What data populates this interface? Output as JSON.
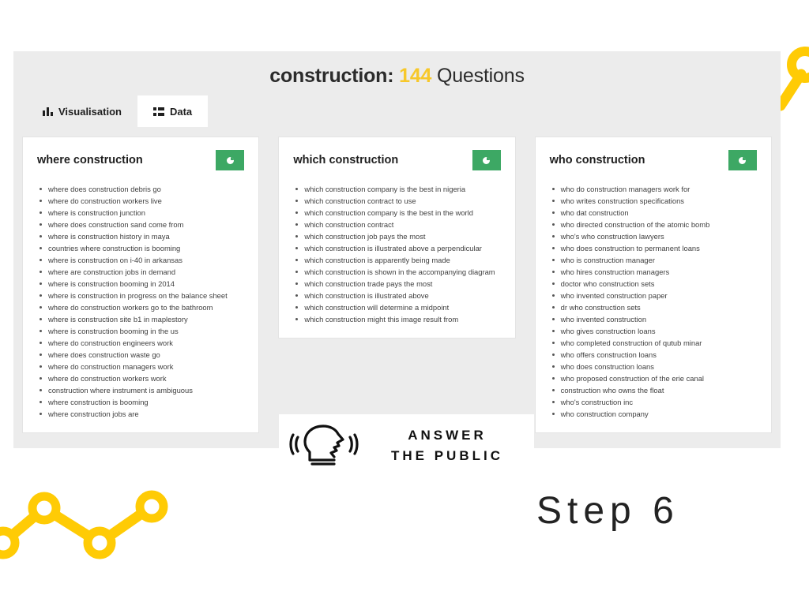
{
  "decor": {
    "accent_yellow": "#ffcb05",
    "topright_icon": "line-chart-node",
    "bottomleft_icon": "line-chart-nodes"
  },
  "panel": {
    "background": "#ececec",
    "title": {
      "keyword": "construction:",
      "count": "144",
      "suffix": "Questions"
    },
    "tabs": [
      {
        "label": "Visualisation",
        "icon": "bar-chart-icon",
        "active": false
      },
      {
        "label": "Data",
        "icon": "list-icon",
        "active": true
      }
    ],
    "cards": [
      {
        "title": "where construction",
        "button_icon": "pie-chart-icon",
        "button_color": "#3da864",
        "items": [
          "where does construction debris go",
          "where do construction workers live",
          "where is construction junction",
          "where does construction sand come from",
          "where is construction history in maya",
          "countries where construction is booming",
          "where is construction on i-40 in arkansas",
          "where are construction jobs in demand",
          "where is construction booming in 2014",
          "where is construction in progress on the balance sheet",
          "where do construction workers go to the bathroom",
          "where is construction site b1 in maplestory",
          "where is construction booming in the us",
          "where do construction engineers work",
          "where does construction waste go",
          "where do construction managers work",
          "where do construction workers work",
          "construction where instrument is ambiguous",
          "where construction is booming",
          "where construction jobs are"
        ]
      },
      {
        "title": "which construction",
        "button_icon": "pie-chart-icon",
        "button_color": "#3da864",
        "items": [
          "which construction company is the best in nigeria",
          "which construction contract to use",
          "which construction company is the best in the world",
          "which construction contract",
          "which construction job pays the most",
          "which construction is illustrated above a perpendicular",
          "which construction is apparently being made",
          "which construction is shown in the accompanying diagram",
          "which construction trade pays the most",
          "which construction is illustrated above",
          "which construction will determine a midpoint",
          "which construction might this image result from"
        ]
      },
      {
        "title": "who construction",
        "button_icon": "pie-chart-icon",
        "button_color": "#3da864",
        "items": [
          "who do construction managers work for",
          "who writes construction specifications",
          "who dat construction",
          "who directed construction of the atomic bomb",
          "who's who construction lawyers",
          "who does construction to permanent loans",
          "who is construction manager",
          "who hires construction managers",
          "doctor who construction sets",
          "who invented construction paper",
          "dr who construction sets",
          "who invented construction",
          "who gives construction loans",
          "who completed construction of qutub minar",
          "who offers construction loans",
          "who does construction loans",
          "who proposed construction of the erie canal",
          "construction who owns the float",
          "who's construction inc",
          "who construction company"
        ]
      }
    ],
    "logo": {
      "icon": "speaking-head-icon",
      "line1": "ANSWER",
      "line2": "THE PUBLIC"
    }
  },
  "step": {
    "label": "Step 6"
  }
}
